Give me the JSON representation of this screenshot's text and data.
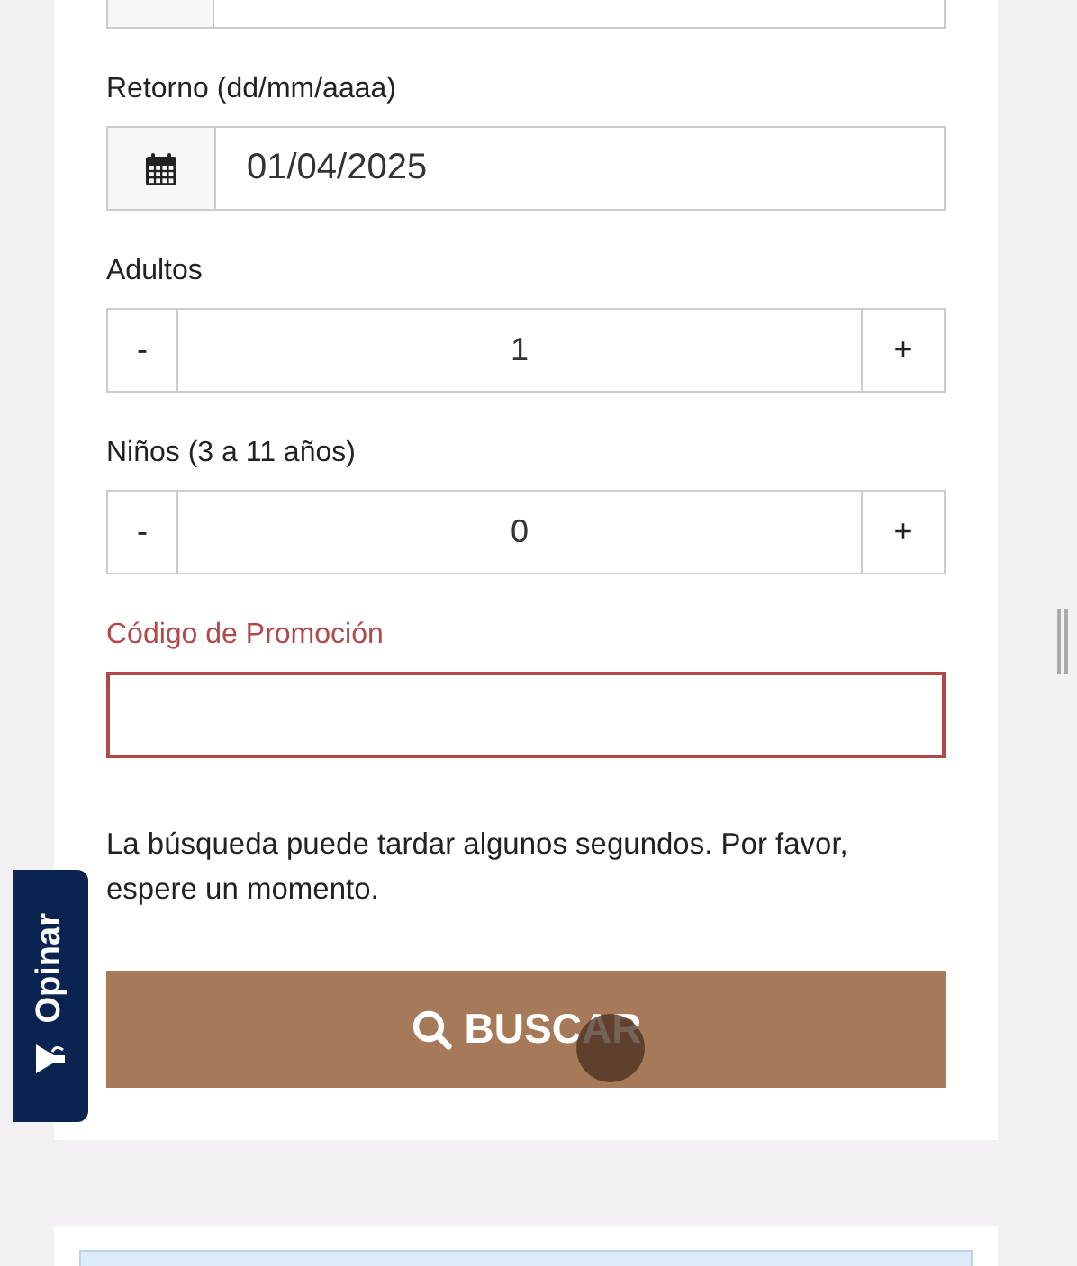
{
  "return_field": {
    "label": "Retorno (dd/mm/aaaa)",
    "value": "01/04/2025"
  },
  "steppers": [
    {
      "label": "Adultos",
      "minus": "-",
      "value": "1",
      "plus": "+"
    },
    {
      "label": "Niños (3 a 11 años)",
      "minus": "-",
      "value": "0",
      "plus": "+"
    }
  ],
  "promo": {
    "label": "Código de Promoción",
    "invalid": true
  },
  "notice": "La búsqueda puede tardar algunos segundos. Por favor, espere un momento.",
  "search_button": {
    "label": "BUSCAR"
  },
  "feedback_tab": {
    "label": "Opinar"
  }
}
